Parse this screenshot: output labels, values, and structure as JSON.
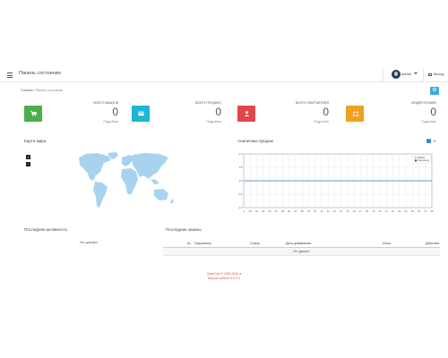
{
  "header": {
    "title": "Панель состояния",
    "user": "admin",
    "logout": "Выход"
  },
  "breadcrumb": {
    "home": "Главная",
    "current": "Панель состояния"
  },
  "stats": [
    {
      "label": "Всего заказов",
      "value": "0",
      "more": "Подробнее",
      "color": "#4cae4c",
      "icon": "cart-icon"
    },
    {
      "label": "Всего продано",
      "value": "0",
      "more": "Подробнее",
      "color": "#1fb5d4",
      "icon": "credit-card-icon"
    },
    {
      "label": "Всего покупателей",
      "value": "0",
      "more": "Подробнее",
      "color": "#e0474c",
      "icon": "user-icon"
    },
    {
      "label": "Людей онлайн",
      "value": "0",
      "more": "Подробнее",
      "color": "#f0a020",
      "icon": "users-icon"
    }
  ],
  "map": {
    "title": "Карта мира",
    "zoom_in": "+",
    "zoom_out": "−",
    "land_color": "#a7d3ef"
  },
  "analytics": {
    "title": "Аналитика продаж",
    "menu_icon": "calendar-icon"
  },
  "chart_data": {
    "type": "line",
    "title": "",
    "x": [
      -1,
      0,
      1,
      2,
      3,
      4,
      5,
      6,
      7,
      8,
      9,
      10,
      11,
      12,
      13,
      14,
      15,
      16,
      17,
      18,
      19,
      20,
      21,
      22,
      23,
      24,
      25,
      26,
      27,
      28
    ],
    "xticks": [
      "-1",
      "00",
      "01",
      "02",
      "03",
      "04",
      "05",
      "06",
      "07",
      "08",
      "09",
      "10",
      "11",
      "12",
      "13",
      "14",
      "15",
      "16",
      "17",
      "18",
      "19",
      "20",
      "21",
      "22",
      "23",
      "24",
      "25",
      "26",
      "27",
      "28"
    ],
    "yticks": [
      "-1.0",
      "-0.5",
      "0.0",
      "0.5",
      "1.0"
    ],
    "xlim": [
      -1,
      28
    ],
    "ylim": [
      -1,
      1
    ],
    "series": [
      {
        "name": "Заказы",
        "values": [
          0,
          0,
          0,
          0,
          0,
          0,
          0,
          0,
          0,
          0,
          0,
          0,
          0,
          0,
          0,
          0,
          0,
          0,
          0,
          0,
          0,
          0,
          0,
          0,
          0,
          0,
          0,
          0,
          0,
          0
        ],
        "color": "#9ec9e2"
      },
      {
        "name": "Покупатели",
        "values": [
          0,
          0,
          0,
          0,
          0,
          0,
          0,
          0,
          0,
          0,
          0,
          0,
          0,
          0,
          0,
          0,
          0,
          0,
          0,
          0,
          0,
          0,
          0,
          0,
          0,
          0,
          0,
          0,
          0,
          0
        ],
        "color": "#1e5f8c"
      }
    ],
    "grid": true,
    "legend": "top-right"
  },
  "activity": {
    "title": "Последняя активность",
    "empty": "Нет данных!"
  },
  "orders": {
    "title": "Последние заказы",
    "columns": [
      "№",
      "Покупатель",
      "Статус",
      "Дата добавления",
      "Итого",
      "Действие"
    ],
    "empty": "Нет данных!"
  },
  "footer": {
    "line1_left": "OpenCart",
    "line1_mid": "© 2009-2024",
    "line1_heart": "♥",
    "line2": "Версия ocStore 4.0.2.3"
  }
}
